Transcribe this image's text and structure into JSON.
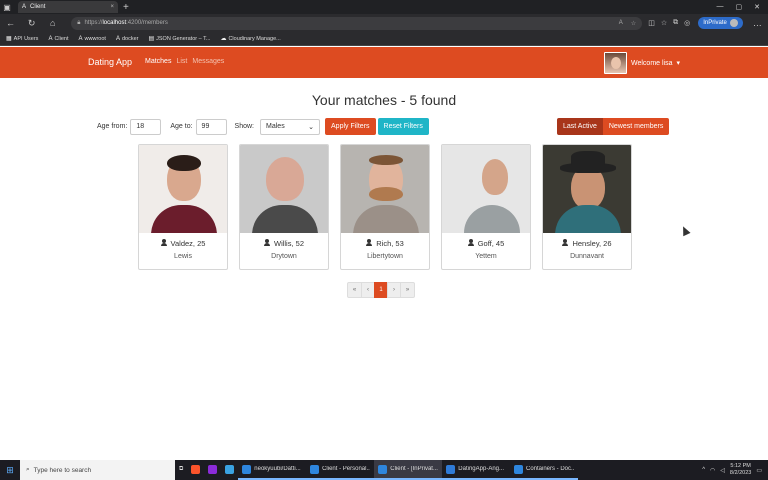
{
  "browser": {
    "tab_title": "Client",
    "tab_close": "×",
    "new_tab": "+",
    "url_prefix": "https://",
    "url_host": "localhost",
    "url_rest": ":4200/members",
    "inprivate_label": "InPrivate",
    "bookmarks": [
      {
        "label": "API Users",
        "icon": "apps-icon"
      },
      {
        "label": "Client",
        "icon": "angular-icon"
      },
      {
        "label": "wwwroot",
        "icon": "angular-icon"
      },
      {
        "label": "docker",
        "icon": "angular-icon"
      },
      {
        "label": "JSON Generator – T...",
        "icon": "json-icon"
      },
      {
        "label": "Cloudinary Manage...",
        "icon": "cloudinary-icon"
      }
    ]
  },
  "navbar": {
    "brand": "Dating App",
    "links": [
      "Matches",
      "List",
      "Messages"
    ],
    "welcome": "Welcome lisa"
  },
  "main": {
    "heading": "Your matches - 5 found",
    "filters": {
      "age_from_label": "Age from:",
      "age_from_value": "18",
      "age_to_label": "Age to:",
      "age_to_value": "99",
      "show_label": "Show:",
      "show_value": "Males",
      "apply_label": "Apply Filters",
      "reset_label": "Reset Filters"
    },
    "sort": {
      "last_active_label": "Last Active",
      "newest_label": "Newest members"
    },
    "members": [
      {
        "name": "Valdez, 25",
        "city": "Lewis"
      },
      {
        "name": "Willis, 52",
        "city": "Drytown"
      },
      {
        "name": "Rich, 53",
        "city": "Libertytown"
      },
      {
        "name": "Goff, 45",
        "city": "Yettem"
      },
      {
        "name": "Hensley, 26",
        "city": "Dunnavant"
      }
    ],
    "pagination": [
      "«",
      "‹",
      "1",
      "›",
      "»"
    ],
    "current_page": "1"
  },
  "taskbar": {
    "search_placeholder": "Type here to search",
    "apps": [
      {
        "label": "neokyuubi/Datti...",
        "color": "#2e86de"
      },
      {
        "label": "Client - Personal...",
        "color": "#2e86de"
      },
      {
        "label": "Client - [InPrivat...",
        "color": "#2e86de"
      },
      {
        "label": "DatingApp-Ang...",
        "color": "#2f7bd8"
      },
      {
        "label": "Containers - Doc...",
        "color": "#2e86de"
      }
    ],
    "time": "5:12 PM",
    "date": "8/2/2023"
  },
  "colors": {
    "brand": "#dd4b21",
    "brand_dark": "#a8351a",
    "reset_btn": "#1fb5c7"
  }
}
